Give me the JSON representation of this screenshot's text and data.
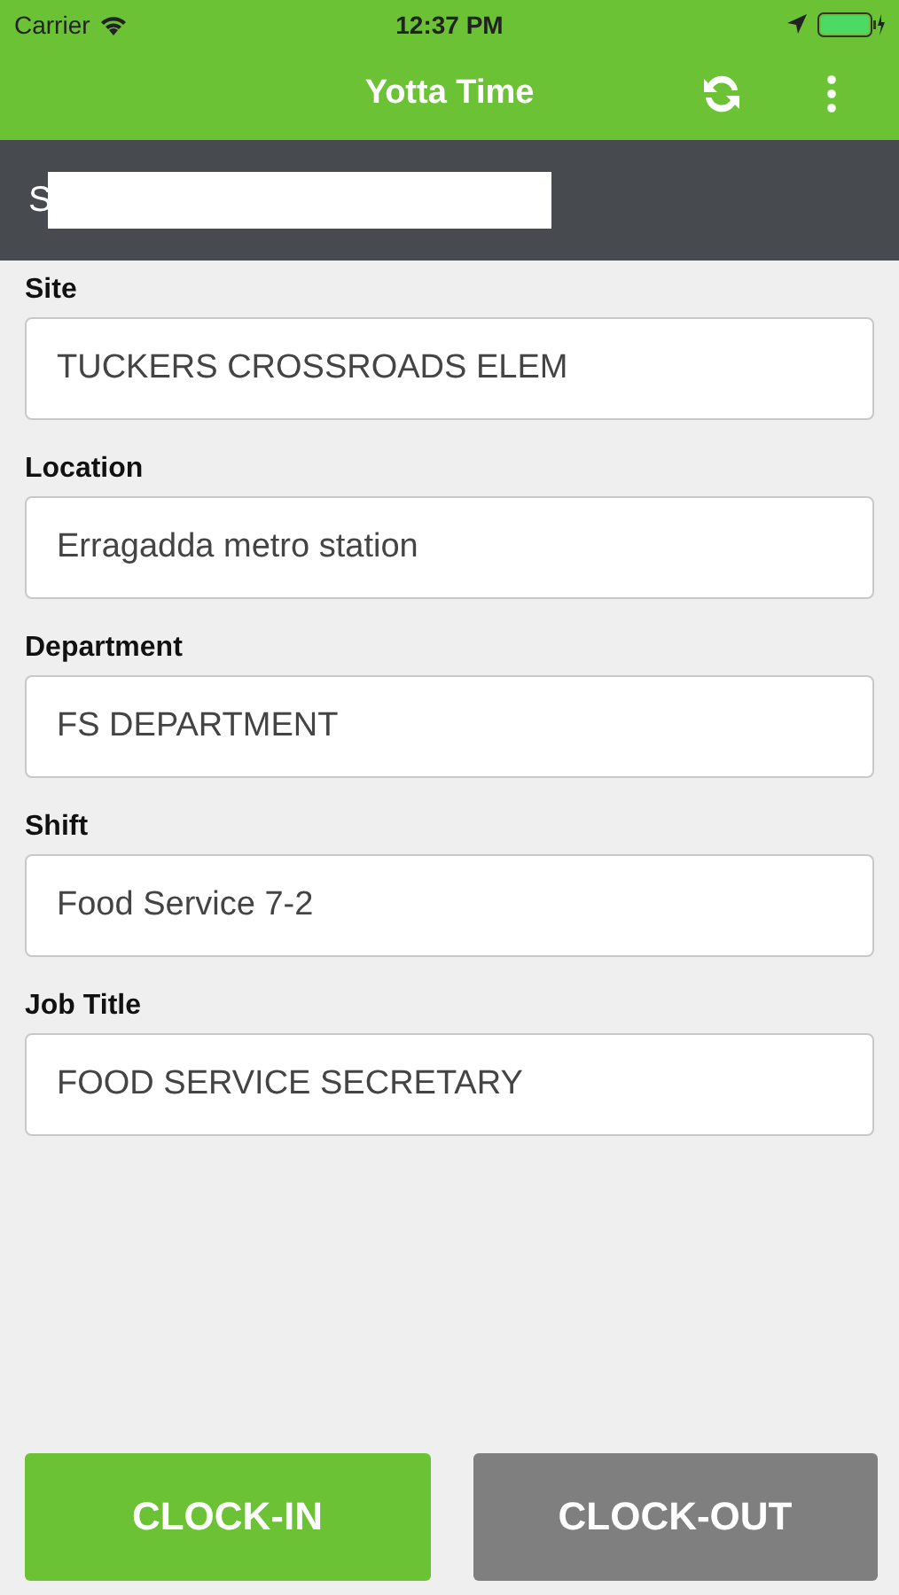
{
  "status_bar": {
    "carrier": "Carrier",
    "time": "12:37 PM"
  },
  "app_bar": {
    "title": "Yotta Time"
  },
  "user_bar": {
    "name": "S"
  },
  "fields": [
    {
      "label": "Site",
      "value": "TUCKERS CROSSROADS ELEM"
    },
    {
      "label": "Location",
      "value": "Erragadda metro station"
    },
    {
      "label": "Department",
      "value": "FS DEPARTMENT"
    },
    {
      "label": "Shift",
      "value": "Food Service 7-2"
    },
    {
      "label": "Job Title",
      "value": "FOOD SERVICE SECRETARY"
    }
  ],
  "buttons": [
    {
      "label": "CLOCK-IN",
      "disabled": false
    },
    {
      "label": "CLOCK-OUT",
      "disabled": true
    }
  ]
}
